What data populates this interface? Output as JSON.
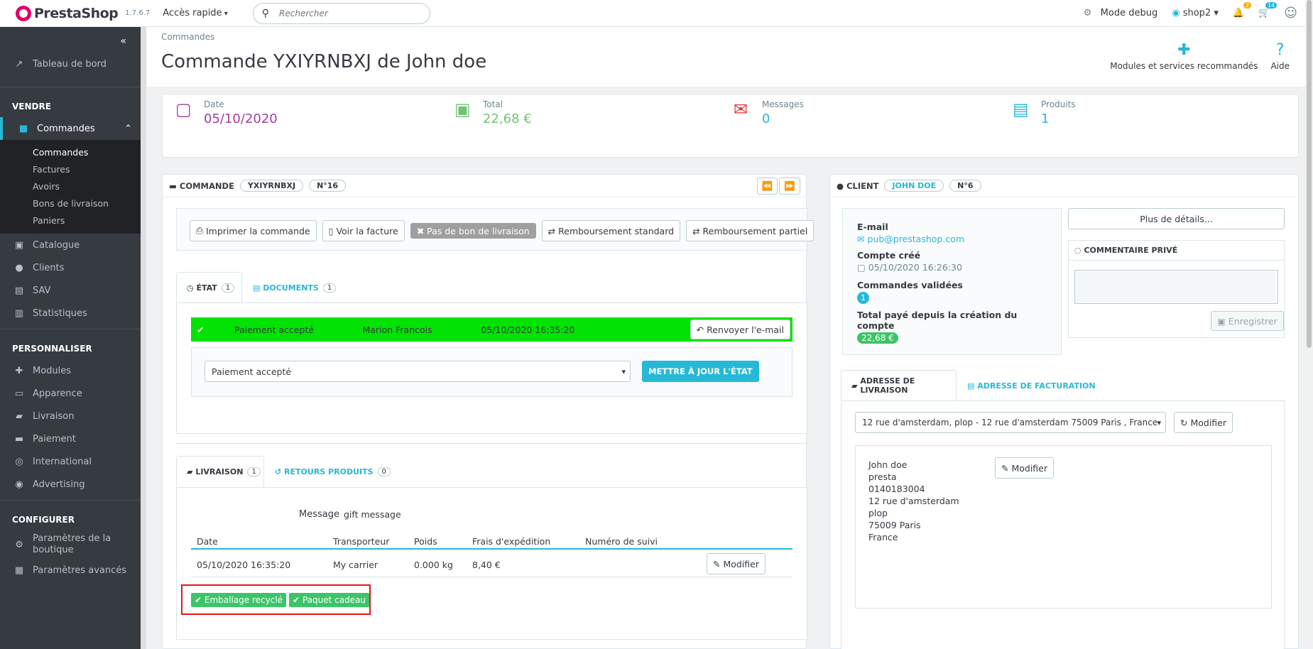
{
  "header": {
    "logo": "PrestaShop",
    "version": "1.7.6.7",
    "quick_access": "Accès rapide",
    "search_placeholder": "Rechercher",
    "debug": "Mode debug",
    "shop": "shop2",
    "notif_orders": "2",
    "notif_customers": "14"
  },
  "sidebar": {
    "dashboard": "Tableau de bord",
    "sell_title": "VENDRE",
    "orders": "Commandes",
    "orders_sub": [
      "Commandes",
      "Factures",
      "Avoirs",
      "Bons de livraison",
      "Paniers"
    ],
    "catalog": "Catalogue",
    "customers": "Clients",
    "sav": "SAV",
    "stats": "Statistiques",
    "customize_title": "PERSONNALISER",
    "modules": "Modules",
    "appearance": "Apparence",
    "shipping": "Livraison",
    "payment": "Paiement",
    "international": "International",
    "advertising": "Advertising",
    "configure_title": "CONFIGURER",
    "shop_params": "Paramètres de la boutique",
    "advanced_params": "Paramètres avancés"
  },
  "page": {
    "breadcrumb": "Commandes",
    "title": "Commande YXIYRNBXJ de John doe",
    "modules_btn": "Modules et services recommandés",
    "help_btn": "Aide"
  },
  "kpi": {
    "date_label": "Date",
    "date_value": "05/10/2020",
    "total_label": "Total",
    "total_value": "22,68 €",
    "messages_label": "Messages",
    "messages_value": "0",
    "products_label": "Produits",
    "products_value": "1",
    "date_color": "#a33ca1",
    "total_color": "#72c279",
    "messages_color": "#25b9d7",
    "products_color": "#25b9d7"
  },
  "order": {
    "title": "COMMANDE",
    "reference": "YXIYRNBXJ",
    "number": "N°16",
    "actions": {
      "print": "Imprimer la commande",
      "invoice": "Voir la facture",
      "no_delivery": "Pas de bon de livraison",
      "refund_standard": "Remboursement standard",
      "refund_partial": "Remboursement partiel"
    },
    "tab_status": "ÉTAT",
    "tab_status_count": "1",
    "tab_documents": "DOCUMENTS",
    "tab_documents_count": "1",
    "status_row": {
      "status": "Paiement accepté",
      "employee": "Marion Francois",
      "date": "05/10/2020 16:35:20",
      "resend": "Renvoyer l'e-mail"
    },
    "status_select": "Paiement accepté",
    "update_state": "METTRE À JOUR L'ÉTAT",
    "tab_shipping": "LIVRAISON",
    "tab_shipping_count": "1",
    "tab_returns": "RETOURS PRODUITS",
    "tab_returns_count": "0",
    "message_label": "Message",
    "message_value": "gift message",
    "table_headers": [
      "Date",
      "Transporteur",
      "Poids",
      "Frais d'expédition",
      "Numéro de suivi"
    ],
    "table_row": [
      "05/10/2020 16:35:20",
      "My carrier",
      "0.000 kg",
      "8,40 €",
      ""
    ],
    "edit": "Modifier",
    "tags": [
      "Emballage recyclé",
      "Paquet cadeau"
    ]
  },
  "client": {
    "title": "CLIENT",
    "name": "JOHN DOE",
    "number": "N°6",
    "email_label": "E-mail",
    "email": "pub@prestashop.com",
    "created_label": "Compte créé",
    "created": "05/10/2020 16:26:30",
    "valid_orders_label": "Commandes validées",
    "valid_orders": "1",
    "total_paid_label": "Total payé depuis la création du compte",
    "total_paid": "22,68 €",
    "more_details": "Plus de détails...",
    "private_comment": "COMMENTAIRE PRIVÉ",
    "save": "Enregistrer",
    "tab_delivery": "ADRESSE DE LIVRAISON",
    "tab_invoice": "ADRESSE DE FACTURATION",
    "address_select": "12 rue d'amsterdam, plop - 12 rue d'amsterdam 75009 Paris , France",
    "edit": "Modifier",
    "address_lines": [
      "John doe",
      "presta",
      "0140183004",
      "12 rue d'amsterdam",
      "plop",
      "75009 Paris",
      "France"
    ]
  }
}
